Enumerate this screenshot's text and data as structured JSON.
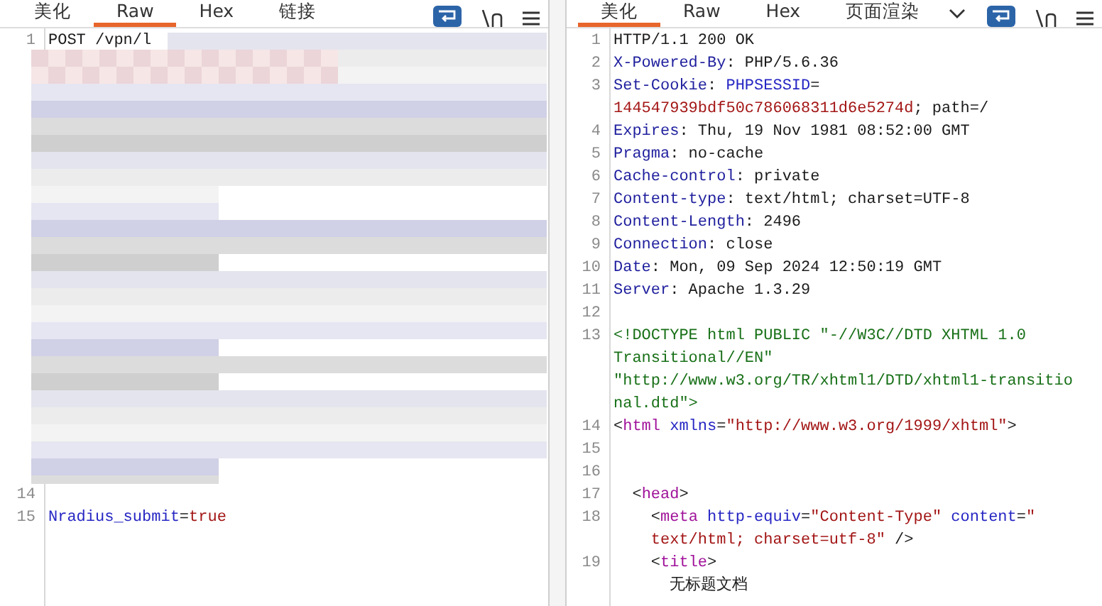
{
  "request": {
    "tabs": [
      {
        "label": "美化",
        "selected": false
      },
      {
        "label": "Raw",
        "selected": true
      },
      {
        "label": "Hex",
        "selected": false
      },
      {
        "label": "链接",
        "selected": false
      }
    ],
    "lines": [
      {
        "kind": "code",
        "number": "1",
        "rows": [
          {
            "parts": [
              {
                "kind": "plain",
                "text": "POST /vpn/l"
              }
            ]
          }
        ]
      },
      {
        "kind": "redacted"
      },
      {
        "kind": "code",
        "number": "14"
      },
      {
        "kind": "code",
        "number": "15",
        "rows": [
          {
            "parts": [
              {
                "kind": "name",
                "text": "Nradius_submit"
              },
              {
                "kind": "plain",
                "text": "="
              },
              {
                "kind": "value",
                "text": "true"
              }
            ]
          }
        ]
      }
    ]
  },
  "response": {
    "tabs": [
      {
        "label": "美化",
        "selected": true
      },
      {
        "label": "Raw",
        "selected": false
      },
      {
        "label": "Hex",
        "selected": false
      },
      {
        "label": "页面渲染",
        "selected": false
      }
    ],
    "dropdown": true,
    "lines": [
      {
        "kind": "code",
        "number": "1",
        "rows": [
          {
            "parts": [
              {
                "kind": "plain",
                "text": "HTTP/1.1 200 OK"
              }
            ]
          }
        ]
      },
      {
        "kind": "code",
        "number": "2",
        "rows": [
          {
            "parts": [
              {
                "kind": "header",
                "text": "X-Powered-By"
              },
              {
                "kind": "plain",
                "text": ": PHP/5.6.36"
              }
            ]
          }
        ]
      },
      {
        "kind": "code",
        "number": "3",
        "rows": [
          {
            "parts": [
              {
                "kind": "header",
                "text": "Set-Cookie"
              },
              {
                "kind": "plain",
                "text": ": "
              },
              {
                "kind": "name",
                "text": "PHPSESSID"
              },
              {
                "kind": "plain",
                "text": "="
              }
            ]
          },
          {
            "parts": [
              {
                "kind": "value",
                "text": "144547939bdf50c786068311d6e5274d"
              },
              {
                "kind": "plain",
                "text": "; path=/"
              }
            ]
          }
        ]
      },
      {
        "kind": "code",
        "number": "4",
        "rows": [
          {
            "parts": [
              {
                "kind": "header",
                "text": "Expires"
              },
              {
                "kind": "plain",
                "text": ": Thu, 19 Nov 1981 08:52:00 GMT"
              }
            ]
          }
        ]
      },
      {
        "kind": "code",
        "number": "5",
        "rows": [
          {
            "parts": [
              {
                "kind": "header",
                "text": "Pragma"
              },
              {
                "kind": "plain",
                "text": ": no-cache"
              }
            ]
          }
        ]
      },
      {
        "kind": "code",
        "number": "6",
        "rows": [
          {
            "parts": [
              {
                "kind": "header",
                "text": "Cache-control"
              },
              {
                "kind": "plain",
                "text": ": private"
              }
            ]
          }
        ]
      },
      {
        "kind": "code",
        "number": "7",
        "rows": [
          {
            "parts": [
              {
                "kind": "header",
                "text": "Content-type"
              },
              {
                "kind": "plain",
                "text": ": text/html; charset=UTF-8"
              }
            ]
          }
        ]
      },
      {
        "kind": "code",
        "number": "8",
        "rows": [
          {
            "parts": [
              {
                "kind": "header",
                "text": "Content-Length"
              },
              {
                "kind": "plain",
                "text": ": 2496"
              }
            ]
          }
        ]
      },
      {
        "kind": "code",
        "number": "9",
        "rows": [
          {
            "parts": [
              {
                "kind": "header",
                "text": "Connection"
              },
              {
                "kind": "plain",
                "text": ": close"
              }
            ]
          }
        ]
      },
      {
        "kind": "code",
        "number": "10",
        "rows": [
          {
            "parts": [
              {
                "kind": "header",
                "text": "Date"
              },
              {
                "kind": "plain",
                "text": ": Mon, 09 Sep 2024 12:50:19 GMT"
              }
            ]
          }
        ]
      },
      {
        "kind": "code",
        "number": "11",
        "rows": [
          {
            "parts": [
              {
                "kind": "header",
                "text": "Server"
              },
              {
                "kind": "plain",
                "text": ": Apache 1.3.29"
              }
            ]
          }
        ]
      },
      {
        "kind": "code",
        "number": "12"
      },
      {
        "kind": "code",
        "number": "13",
        "rows": [
          {
            "parts": [
              {
                "kind": "doctype",
                "text": "<!DOCTYPE html PUBLIC \"-//W3C//DTD XHTML 1.0"
              }
            ]
          },
          {
            "parts": [
              {
                "kind": "doctype",
                "text": "Transitional//EN\""
              }
            ]
          },
          {
            "parts": [
              {
                "kind": "doctype",
                "text": "\"http://www.w3.org/TR/xhtml1/DTD/xhtml1-transitio"
              }
            ]
          },
          {
            "parts": [
              {
                "kind": "doctype",
                "text": "nal.dtd\">"
              }
            ]
          }
        ]
      },
      {
        "kind": "code",
        "number": "14",
        "rows": [
          {
            "parts": [
              {
                "kind": "plain",
                "text": "<"
              },
              {
                "kind": "tag",
                "text": "html"
              },
              {
                "kind": "name",
                "text": " xmlns"
              },
              {
                "kind": "plain",
                "text": "="
              },
              {
                "kind": "value",
                "text": "\"http://www.w3.org/1999/xhtml\""
              },
              {
                "kind": "plain",
                "text": ">"
              }
            ]
          }
        ]
      },
      {
        "kind": "code",
        "number": "15"
      },
      {
        "kind": "code",
        "number": "16"
      },
      {
        "kind": "code",
        "number": "17",
        "rows": [
          {
            "parts": [
              {
                "kind": "plain",
                "text": "  <"
              },
              {
                "kind": "tag",
                "text": "head"
              },
              {
                "kind": "plain",
                "text": ">"
              }
            ]
          }
        ]
      },
      {
        "kind": "code",
        "number": "18",
        "rows": [
          {
            "parts": [
              {
                "kind": "plain",
                "text": "    <"
              },
              {
                "kind": "tag",
                "text": "meta"
              },
              {
                "kind": "name",
                "text": " http-equiv"
              },
              {
                "kind": "plain",
                "text": "="
              },
              {
                "kind": "value",
                "text": "\"Content-Type\""
              },
              {
                "kind": "name",
                "text": " content"
              },
              {
                "kind": "plain",
                "text": "="
              },
              {
                "kind": "value",
                "text": "\""
              }
            ]
          },
          {
            "parts": [
              {
                "kind": "value",
                "text": "    text/html; charset=utf-8\""
              },
              {
                "kind": "plain",
                "text": " />"
              }
            ]
          }
        ]
      },
      {
        "kind": "code",
        "number": "19",
        "rows": [
          {
            "parts": [
              {
                "kind": "plain",
                "text": "    <"
              },
              {
                "kind": "tag",
                "text": "title"
              },
              {
                "kind": "plain",
                "text": ">"
              }
            ]
          },
          {
            "parts": [
              {
                "kind": "text",
                "text": "      无标题文档"
              }
            ]
          }
        ]
      }
    ]
  }
}
